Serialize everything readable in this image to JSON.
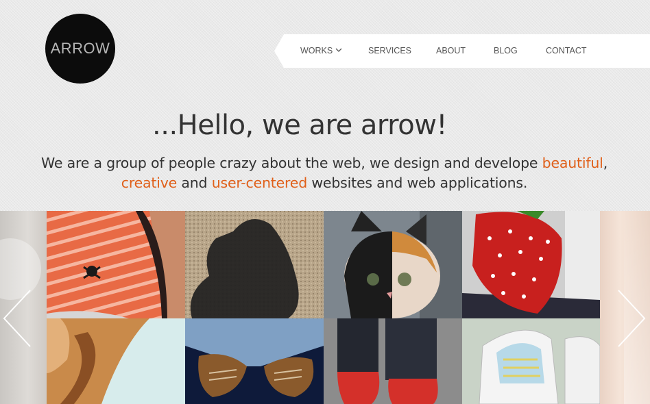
{
  "logo": {
    "text": "ARROW"
  },
  "nav": {
    "items": [
      {
        "label": "WORKS",
        "has_dropdown": true
      },
      {
        "label": "SERVICES"
      },
      {
        "label": "ABOUT"
      },
      {
        "label": "BLOG"
      },
      {
        "label": "CONTACT"
      }
    ]
  },
  "hero": {
    "headline": "...Hello, we are arrow!",
    "intro_part1": "We are a group of people crazy about the web,  we design and develope ",
    "intro_hl1": "beautiful",
    "intro_sep1": ",",
    "intro_hl2": "creative",
    "intro_part2": " and ",
    "intro_hl3": "user-centered",
    "intro_part3": " websites and web applications."
  },
  "gallery": {
    "photos": [
      {
        "subject": "striped-shirt-photo"
      },
      {
        "subject": "shadow-photo"
      },
      {
        "subject": "kitten-photo"
      },
      {
        "subject": "strawberry-photo"
      },
      {
        "subject": "hand-photo"
      },
      {
        "subject": "jeans-shoes-photo"
      },
      {
        "subject": "red-shoes-photo"
      },
      {
        "subject": "sneakers-photo"
      }
    ]
  },
  "colors": {
    "accent": "#e0601a",
    "logo_bg": "#0c0c0c",
    "logo_text": "#b5b5b5",
    "text": "#333333"
  }
}
